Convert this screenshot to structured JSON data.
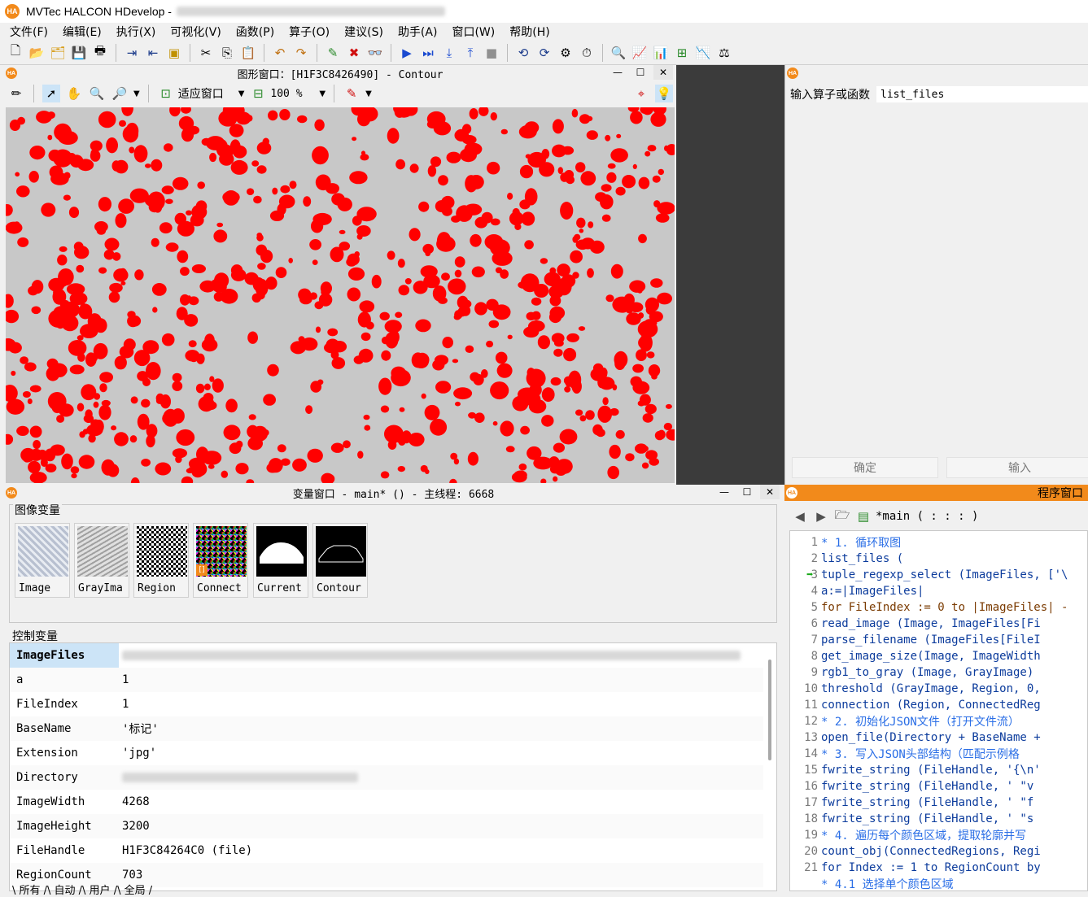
{
  "app": {
    "title": "MVTec HALCON HDevelop -",
    "logo": "HA"
  },
  "menu": [
    "文件(F)",
    "编辑(E)",
    "执行(X)",
    "可视化(V)",
    "函数(P)",
    "算子(O)",
    "建议(S)",
    "助手(A)",
    "窗口(W)",
    "帮助(H)"
  ],
  "graphics_window": {
    "title": "图形窗口：[H1F3C8426490] - Contour",
    "fit_window_label": "适应窗口",
    "zoom_value": "100 %",
    "icons": [
      "pencil-icon",
      "pointer-icon",
      "hand-icon",
      "zoom-icon",
      "zoom-in-icon",
      "fit-window-icon",
      "zoom-level-icon",
      "color-picker-icon",
      "magnifier-icon",
      "lightbulb-icon"
    ]
  },
  "operator_window": {
    "input_label": "输入算子或函数",
    "input_value": "list_files",
    "ok_button": "确定",
    "enter_button": "输入"
  },
  "variable_window": {
    "title": "变量窗口 - main* () - 主线程: 6668",
    "iconic_label": "图像变量",
    "control_label": "控制变量",
    "iconic_vars": [
      "Image",
      "GrayIma",
      "Region",
      "Connect",
      "Current",
      "Contour"
    ],
    "control_vars": [
      {
        "name": "ImageFiles",
        "value": ""
      },
      {
        "name": "a",
        "value": "1"
      },
      {
        "name": "FileIndex",
        "value": "1"
      },
      {
        "name": "BaseName",
        "value": "'标记'"
      },
      {
        "name": "Extension",
        "value": "'jpg'"
      },
      {
        "name": "Directory",
        "value": ""
      },
      {
        "name": "ImageWidth",
        "value": "4268"
      },
      {
        "name": "ImageHeight",
        "value": "3200"
      },
      {
        "name": "FileHandle",
        "value": "H1F3C84264C0 (file)"
      },
      {
        "name": "RegionCount",
        "value": "703"
      }
    ],
    "tabs": "\\ 所有 /\\ 自动 /\\ 用户 /\\ 全局 /"
  },
  "program_window": {
    "title": "程序窗口",
    "procedure": "*main ( : : : )",
    "lines": [
      {
        "n": "1",
        "text": "* 1. 循环取图",
        "type": "comment"
      },
      {
        "n": "2",
        "text": "list_files (",
        "type": "code"
      },
      {
        "n": "3",
        "text": "tuple_regexp_select (ImageFiles, ['\\",
        "type": "code"
      },
      {
        "n": "4",
        "text": "a:=|ImageFiles|",
        "type": "code"
      },
      {
        "n": "5",
        "text": "for FileIndex := 0 to |ImageFiles| -",
        "type": "selected"
      },
      {
        "n": "6",
        "text": "    read_image (Image, ImageFiles[Fi",
        "type": "code"
      },
      {
        "n": "7",
        "text": "    parse_filename (ImageFiles[FileI",
        "type": "code"
      },
      {
        "n": "8",
        "text": "    get_image_size(Image, ImageWidth",
        "type": "code"
      },
      {
        "n": "9",
        "text": "    rgb1_to_gray (Image, GrayImage)",
        "type": "code"
      },
      {
        "n": "10",
        "text": "    threshold (GrayImage, Region, 0,",
        "type": "code"
      },
      {
        "n": "11",
        "text": "    connection (Region, ConnectedReg",
        "type": "code"
      },
      {
        "n": "12",
        "text": "    * 2. 初始化JSON文件（打开文件流）",
        "type": "comment"
      },
      {
        "n": "13",
        "text": "    open_file(Directory + BaseName +",
        "type": "code"
      },
      {
        "n": "14",
        "text": "    * 3. 写入JSON头部结构（匹配示例格",
        "type": "comment"
      },
      {
        "n": "15",
        "text": "    fwrite_string (FileHandle, '{\\n'",
        "type": "code"
      },
      {
        "n": "16",
        "text": "    fwrite_string (FileHandle, '  \"v",
        "type": "code"
      },
      {
        "n": "17",
        "text": "    fwrite_string (FileHandle, '  \"f",
        "type": "code"
      },
      {
        "n": "18",
        "text": "    fwrite_string (FileHandle, '  \"s",
        "type": "code"
      },
      {
        "n": "19",
        "text": "    * 4. 遍历每个颜色区域，提取轮廓并写",
        "type": "comment"
      },
      {
        "n": "20",
        "text": "    count_obj(ConnectedRegions, Regi",
        "type": "code"
      },
      {
        "n": "21",
        "text": "    for Index := 1 to RegionCount by",
        "type": "code"
      },
      {
        "n": "",
        "text": "        * 4.1 选择单个颜色区域",
        "type": "comment"
      }
    ]
  },
  "colors": {
    "accent": "#f28a1b",
    "blob_red": "#ff0000",
    "canvas_bg": "#c8c8c8"
  }
}
